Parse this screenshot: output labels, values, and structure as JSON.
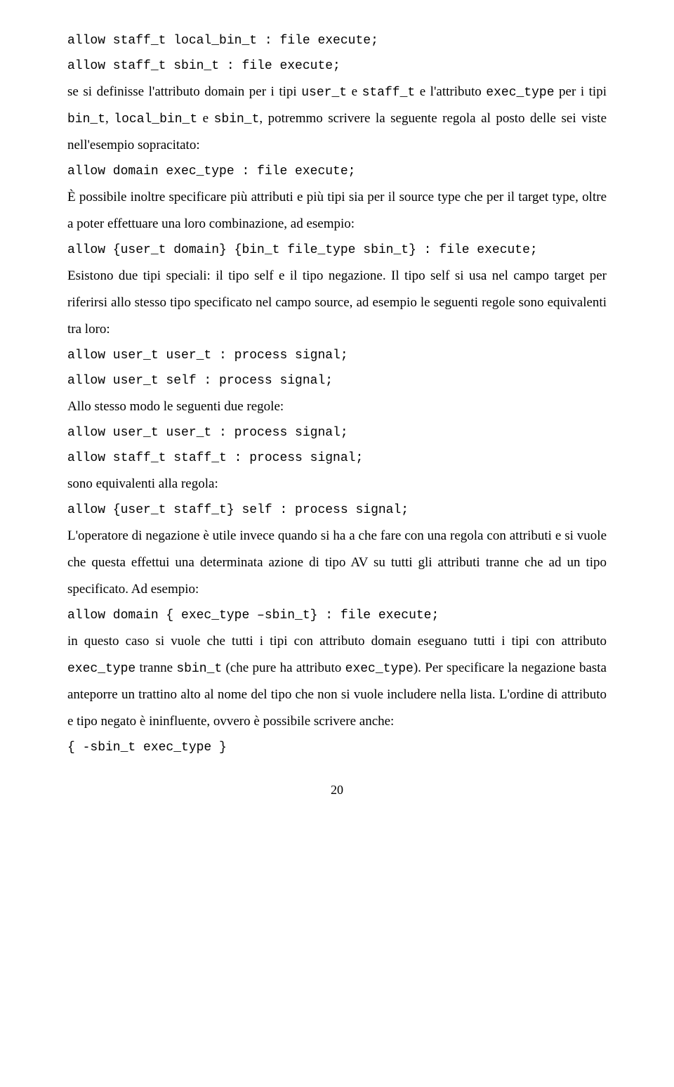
{
  "c1": "allow staff_t local_bin_t : file execute;",
  "c2": "allow staff_t sbin_t : file execute;",
  "p1a": "se si definisse l'attributo domain per i tipi ",
  "p1b": "user_t",
  "p1c": " e ",
  "p1d": "staff_t",
  "p1e": " e l'attributo ",
  "p1f": "exec_type",
  "p1g": " per i tipi ",
  "p1h": "bin_t",
  "p1i": ", ",
  "p1j": "local_bin_t",
  "p1k": " e ",
  "p1l": "sbin_t",
  "p1m": ", potremmo scrivere la seguente regola al posto delle sei viste nell'esempio sopracitato:",
  "c3": "allow domain exec_type : file execute;",
  "p2": "È possibile inoltre specificare più attributi e più tipi sia per il source type che per il target type, oltre a poter effettuare una loro combinazione, ad esempio:",
  "c4": "allow {user_t domain} {bin_t file_type sbin_t} : file execute;",
  "p3": "Esistono due tipi speciali: il tipo self e il tipo negazione. Il tipo self si usa nel campo target per riferirsi allo stesso tipo specificato nel campo source, ad esempio le seguenti regole sono equivalenti tra loro:",
  "c5": "allow user_t user_t : process signal;",
  "c6": "allow user_t self : process signal;",
  "p4": "Allo stesso modo le seguenti due regole:",
  "c7": "allow user_t user_t : process signal;",
  "c8": "allow staff_t staff_t : process signal;",
  "p5": "sono equivalenti alla regola:",
  "c9": "allow {user_t staff_t} self : process signal;",
  "p6": "L'operatore di negazione è utile invece quando si ha a che fare con una regola con attributi e si vuole che questa effettui una determinata azione di tipo AV su tutti gli attributi tranne che ad un tipo specificato. Ad esempio:",
  "c10": "allow domain { exec_type –sbin_t} : file execute;",
  "p7a": "in questo caso si vuole che tutti i tipi con attributo domain eseguano tutti i tipi con attributo ",
  "p7b": "exec_type",
  "p7c": " tranne ",
  "p7d": "sbin_t",
  "p7e": " (che pure ha attributo ",
  "p7f": "exec_type",
  "p7g": "). Per specificare la negazione basta anteporre un trattino alto al nome del tipo che non si vuole includere nella lista. L'ordine di attributo e tipo negato è ininfluente, ovvero è possibile scrivere anche:",
  "c11": "{ -sbin_t exec_type }",
  "page_number": "20"
}
